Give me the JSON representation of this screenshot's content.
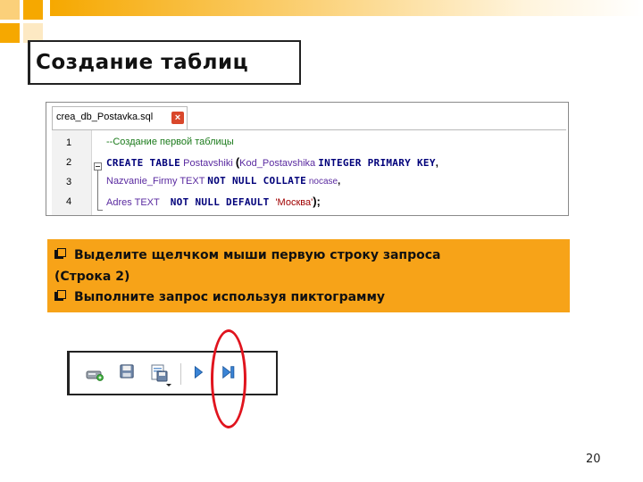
{
  "slide": {
    "title": "Создание таблиц",
    "page_number": "20"
  },
  "editor": {
    "tab_label": "crea_db_Postavka.sql",
    "close_glyph": "×",
    "lines": [
      {
        "num": "1",
        "comment": "--Создание первой таблицы"
      },
      {
        "num": "2",
        "kw1": "CREATE  TABLE",
        "id1": " Postavshiki ",
        "paren": "(",
        "id2": "Kod_Postavshika ",
        "kw2": "INTEGER  PRIMARY  KEY",
        "punct": ","
      },
      {
        "num": "3",
        "id1": "Nazvanie_Firmy",
        "id2": " TEXT ",
        "kw1": "NOT  NULL  COLLATE",
        "id3": " nocase",
        "punct": ","
      },
      {
        "num": "4",
        "id1": "Adres",
        "id2": " TEXT    ",
        "kw1": "NOT  NULL  DEFAULT ",
        "str": "'Москва'",
        "punct": ");"
      }
    ]
  },
  "instructions": {
    "line1": "Выделите щелчком мыши первую строку запроса",
    "line2": "(Строка 2)",
    "line3": "Выполните запрос используя пиктограмму"
  },
  "toolbar": {
    "icons": [
      "new-db-icon",
      "save-icon",
      "save-as-icon",
      "execute-icon",
      "execute-line-icon"
    ]
  },
  "colors": {
    "panel": "#f7a318",
    "highlight_ellipse": "#e0141e",
    "keyword": "#00007a",
    "identifier": "#5a2aa0",
    "comment": "#1a7a1a",
    "string": "#a00000"
  }
}
